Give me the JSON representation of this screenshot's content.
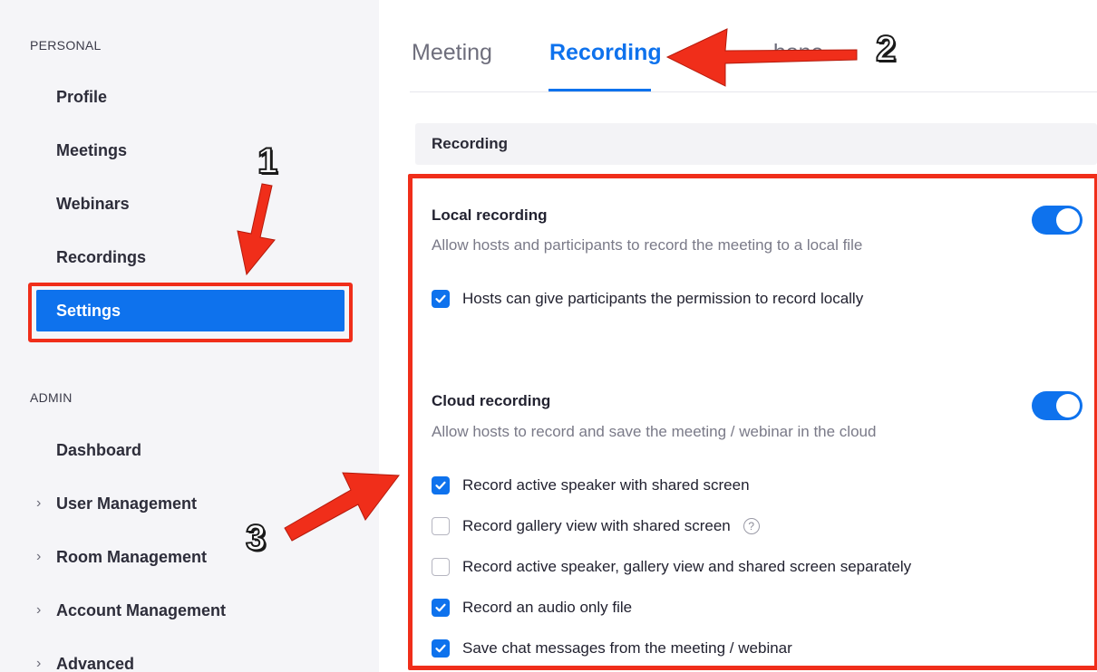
{
  "sidebar": {
    "personal_heading": "PERSONAL",
    "admin_heading": "ADMIN",
    "personal_items": [
      {
        "label": "Profile"
      },
      {
        "label": "Meetings"
      },
      {
        "label": "Webinars"
      },
      {
        "label": "Recordings"
      },
      {
        "label": "Settings",
        "active": true
      }
    ],
    "admin_items": [
      {
        "label": "Dashboard"
      },
      {
        "label": "User Management",
        "expandable": true
      },
      {
        "label": "Room Management",
        "expandable": true
      },
      {
        "label": "Account Management",
        "expandable": true
      },
      {
        "label": "Advanced",
        "expandable": true
      }
    ],
    "chevron_glyph": "›"
  },
  "tabs": [
    {
      "label": "Meeting"
    },
    {
      "label": "Recording",
      "active": true
    },
    {
      "label": "...hone",
      "partially_hidden": true
    }
  ],
  "section_title": "Recording",
  "local_recording": {
    "title": "Local recording",
    "description": "Allow hosts and participants to record the meeting to a local file",
    "enabled": true,
    "options": [
      {
        "label": "Hosts can give participants the permission to record locally",
        "checked": true
      }
    ]
  },
  "cloud_recording": {
    "title": "Cloud recording",
    "description": "Allow hosts to record and save the meeting / webinar in the cloud",
    "enabled": true,
    "options": [
      {
        "label": "Record active speaker with shared screen",
        "checked": true
      },
      {
        "label": "Record gallery view with shared screen",
        "checked": false,
        "help": true
      },
      {
        "label": "Record active speaker, gallery view and shared screen separately",
        "checked": false
      },
      {
        "label": "Record an audio only file",
        "checked": true
      },
      {
        "label": "Save chat messages from the meeting / webinar",
        "checked": true
      }
    ]
  },
  "annotations": {
    "step1": "1",
    "step2": "2",
    "step3": "3",
    "color": "#f02e1a"
  },
  "colors": {
    "accent": "#0e72ed",
    "sidebar_bg": "#f5f5f8",
    "highlight": "#f02e1a"
  }
}
